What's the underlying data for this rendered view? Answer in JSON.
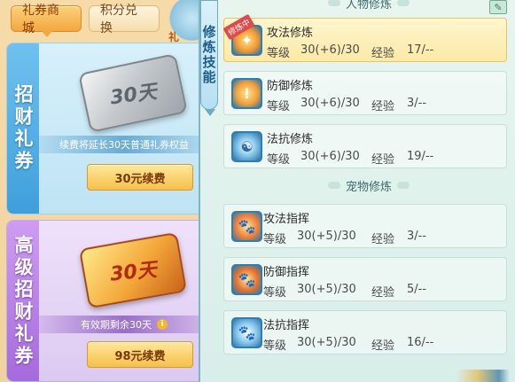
{
  "left": {
    "tabs": {
      "gift_shop": "礼券商城",
      "points_exchange": "积分兑换"
    },
    "mascot_text": "礼",
    "card_normal": {
      "side_label": "招财礼券",
      "ticket_text": "30天",
      "description": "续费将延长30天普通礼券权益",
      "button": "30元续费"
    },
    "card_advanced": {
      "side_label": "高级招财礼券",
      "ticket_text": "30天",
      "description": "有效期剩余30天",
      "info_icon": "i",
      "button": "98元续费"
    }
  },
  "right": {
    "vertical_title": "修炼技能",
    "sections": {
      "character": "人物修炼",
      "pet": "宠物修炼"
    },
    "labels": {
      "level": "等级",
      "exp": "经验"
    },
    "character_skills": [
      {
        "name": "攻法修炼",
        "level": "30(+6)/30",
        "exp": "17/--",
        "badge": "修炼中",
        "icon": "attack-magic-icon"
      },
      {
        "name": "防御修炼",
        "level": "30(+6)/30",
        "exp": "3/--",
        "icon": "defense-shield-icon"
      },
      {
        "name": "法抗修炼",
        "level": "30(+6)/30",
        "exp": "19/--",
        "icon": "magic-resist-icon"
      }
    ],
    "pet_skills": [
      {
        "name": "攻法指挥",
        "level": "30(+5)/30",
        "exp": "3/--",
        "icon": "pet-attack-paw-icon"
      },
      {
        "name": "防御指挥",
        "level": "30(+5)/30",
        "exp": "5/--",
        "icon": "pet-defense-paw-icon"
      },
      {
        "name": "法抗指挥",
        "level": "30(+5)/30",
        "exp": "16/--",
        "icon": "pet-resist-paw-icon"
      }
    ]
  }
}
